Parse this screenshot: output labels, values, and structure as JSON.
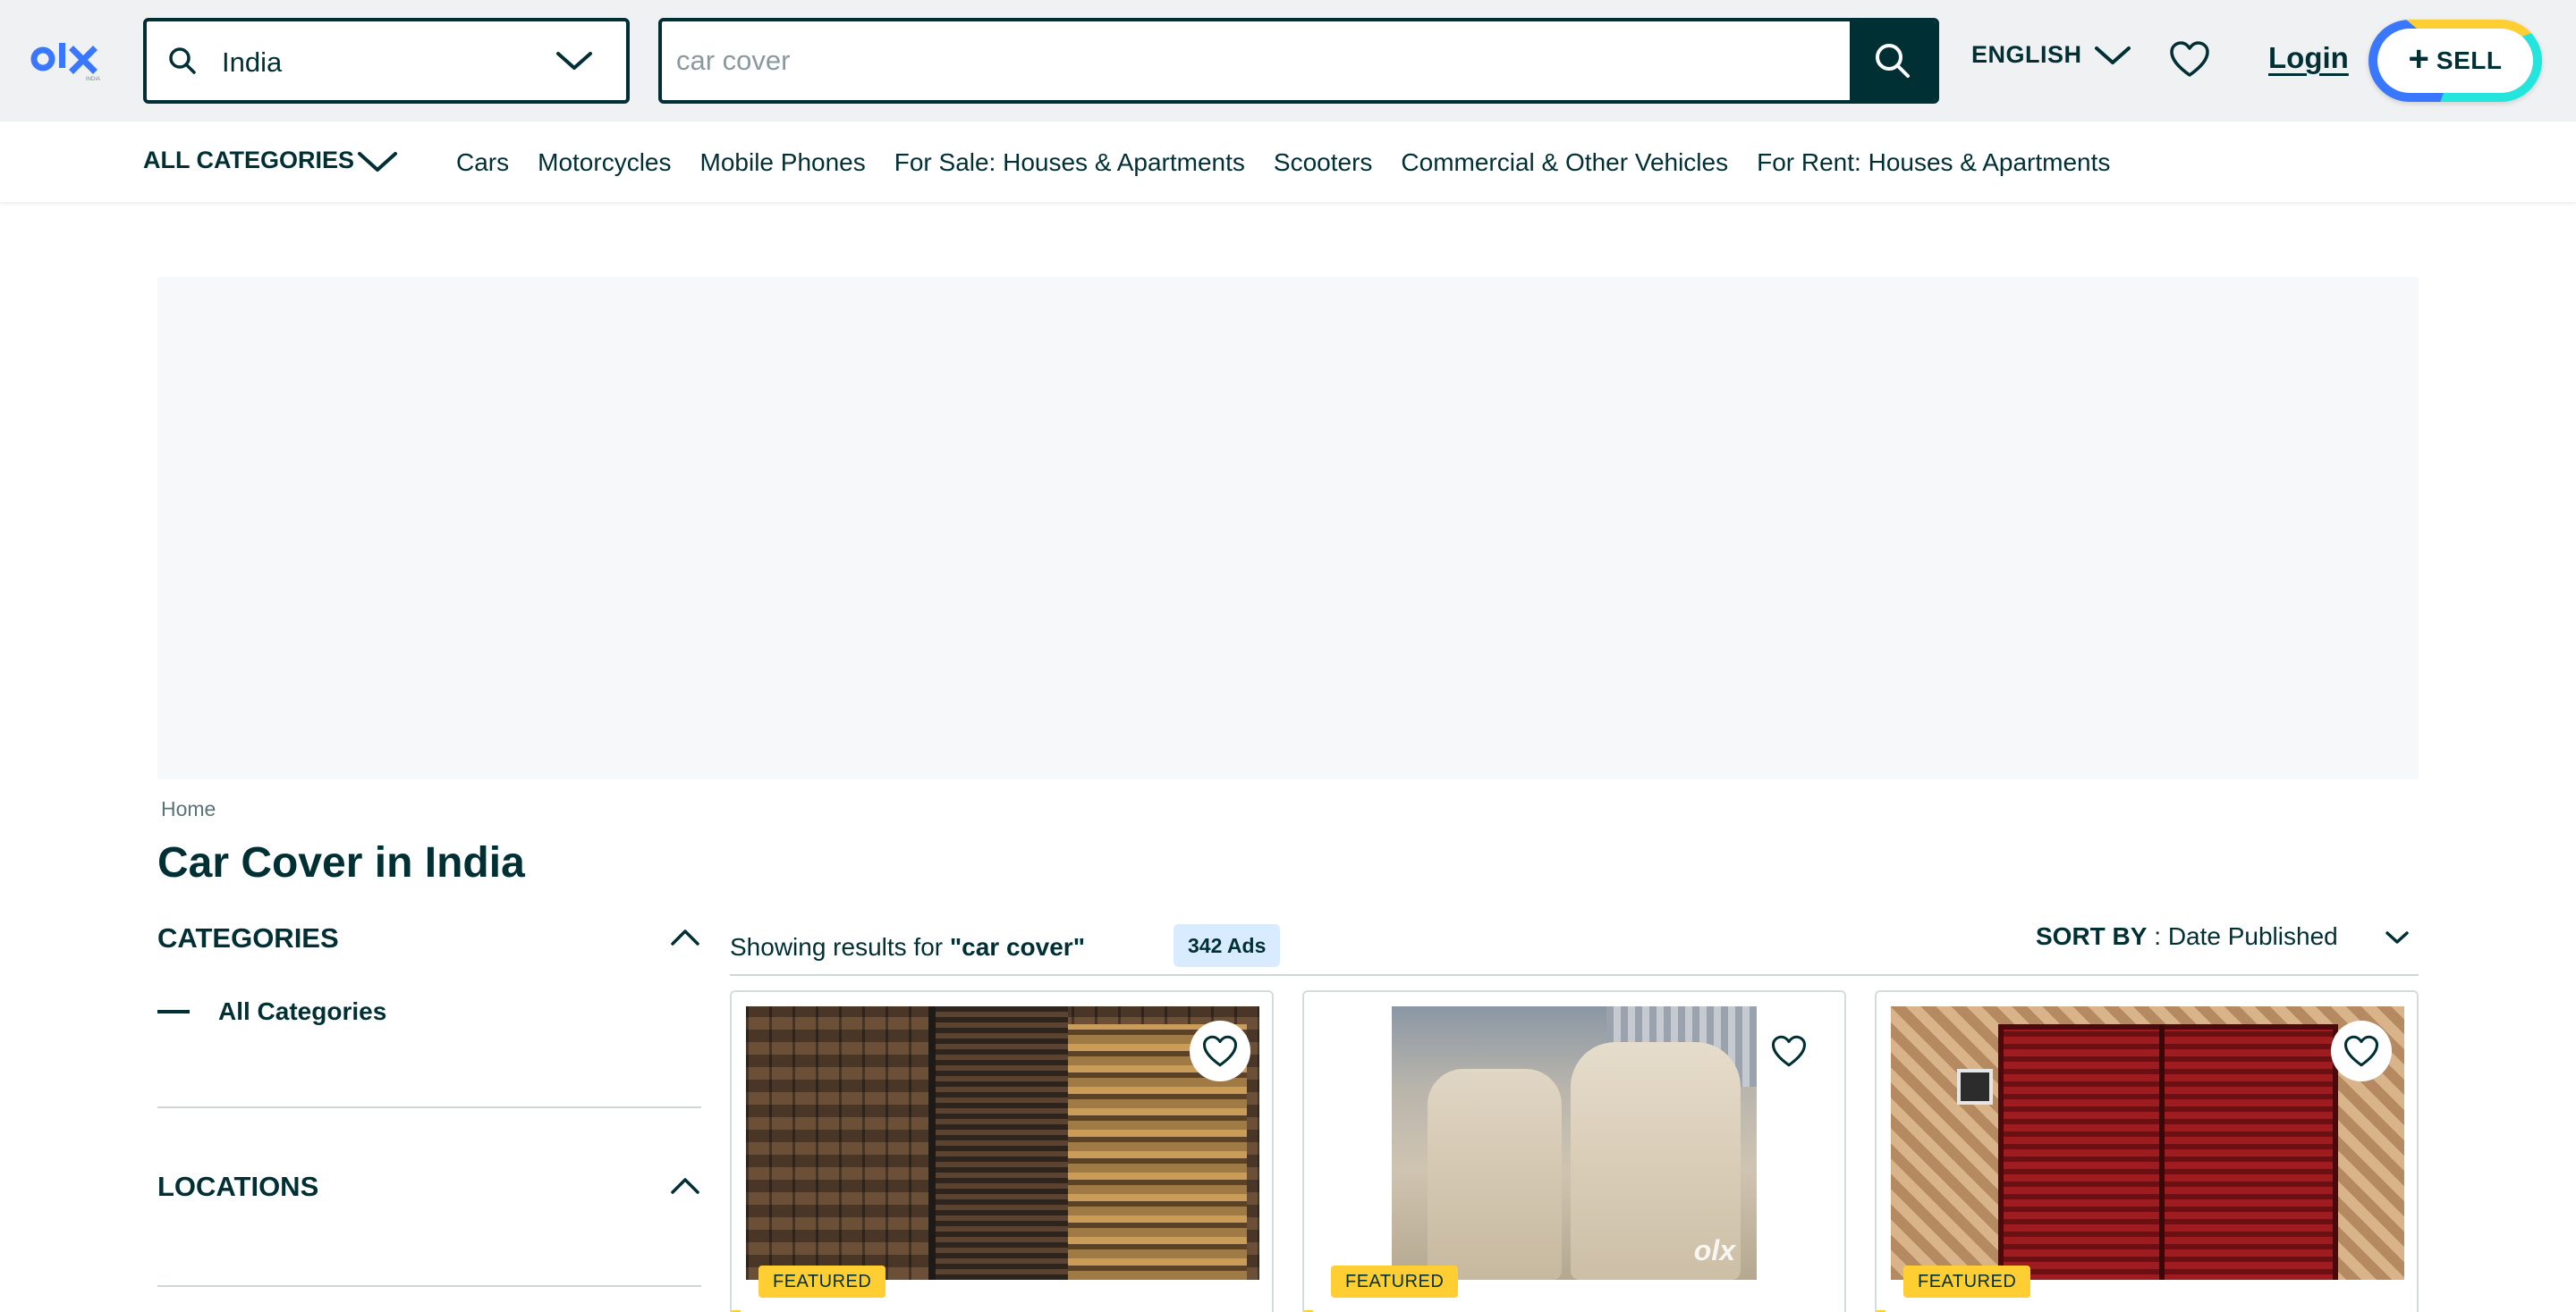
{
  "header": {
    "logo_text": "olx",
    "location": "India",
    "search_placeholder": "car cover",
    "language": "ENGLISH",
    "login_label": "Login",
    "sell_label": "SELL"
  },
  "nav": {
    "all_categories": "ALL CATEGORIES",
    "links": [
      "Cars",
      "Motorcycles",
      "Mobile Phones",
      "For Sale: Houses & Apartments",
      "Scooters",
      "Commercial & Other Vehicles",
      "For Rent: Houses & Apartments"
    ]
  },
  "breadcrumb": "Home",
  "page_title": "Car Cover in India",
  "sidebar": {
    "categories_heading": "CATEGORIES",
    "all_categories_item": "All Categories",
    "locations_heading": "LOCATIONS"
  },
  "results": {
    "showing_prefix": "Showing results for ",
    "query": "\"car cover\"",
    "ads_count": "342 Ads",
    "sort_label": "SORT BY",
    "sort_sep": " : ",
    "sort_value": "Date Published"
  },
  "cards": [
    {
      "badge": "FEATURED"
    },
    {
      "badge": "FEATURED",
      "watermark": "olx"
    },
    {
      "badge": "FEATURED"
    }
  ],
  "colors": {
    "primary": "#002f34",
    "featured": "#ffce32",
    "header_bg": "#eff1f3",
    "logo_blue": "#3a77ff",
    "badge_bg": "#d8ebff"
  },
  "icons": [
    "olx-logo",
    "search-icon",
    "chevron-down-icon",
    "heart-icon",
    "plus-icon",
    "chevron-up-icon"
  ]
}
